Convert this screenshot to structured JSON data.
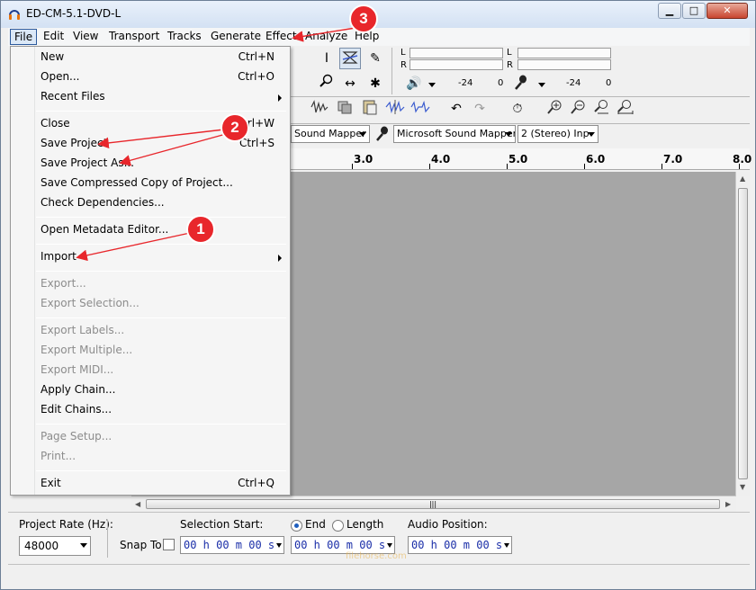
{
  "window": {
    "title": "ED-CM-5.1-DVD-L"
  },
  "menubar": {
    "items": [
      {
        "label": "File"
      },
      {
        "label": "Edit"
      },
      {
        "label": "View"
      },
      {
        "label": "Transport"
      },
      {
        "label": "Tracks"
      },
      {
        "label": "Generate"
      },
      {
        "label": "Effect"
      },
      {
        "label": "Analyze"
      },
      {
        "label": "Help"
      }
    ]
  },
  "file_menu": {
    "items": [
      {
        "label": "New",
        "shortcut": "Ctrl+N"
      },
      {
        "label": "Open...",
        "shortcut": "Ctrl+O"
      },
      {
        "label": "Recent Files",
        "shortcut": ""
      },
      {
        "label": "Close",
        "shortcut": "Ctrl+W"
      },
      {
        "label": "Save Project",
        "shortcut": "Ctrl+S"
      },
      {
        "label": "Save Project As...",
        "shortcut": ""
      },
      {
        "label": "Save Compressed Copy of Project...",
        "shortcut": ""
      },
      {
        "label": "Check Dependencies...",
        "shortcut": ""
      },
      {
        "label": "Open Metadata Editor...",
        "shortcut": ""
      },
      {
        "label": "Import",
        "shortcut": ""
      },
      {
        "label": "Export...",
        "shortcut": ""
      },
      {
        "label": "Export Selection...",
        "shortcut": ""
      },
      {
        "label": "Export Labels...",
        "shortcut": ""
      },
      {
        "label": "Export Multiple...",
        "shortcut": ""
      },
      {
        "label": "Export MIDI...",
        "shortcut": ""
      },
      {
        "label": "Apply Chain...",
        "shortcut": ""
      },
      {
        "label": "Edit Chains...",
        "shortcut": ""
      },
      {
        "label": "Page Setup...",
        "shortcut": ""
      },
      {
        "label": "Print...",
        "shortcut": ""
      },
      {
        "label": "Exit",
        "shortcut": "Ctrl+Q"
      }
    ]
  },
  "meters": {
    "channel_l": "L",
    "channel_r": "R",
    "play_db": "-24",
    "play_zero": "0",
    "rec_db": "-24",
    "rec_zero": "0"
  },
  "devices": {
    "host": "Sound Mapper",
    "recording": "Microsoft Sound Mapper",
    "channels": "2 (Stereo) Inp"
  },
  "ruler": {
    "ticks": [
      "3.0",
      "4.0",
      "5.0",
      "6.0",
      "7.0",
      "8.0"
    ]
  },
  "selection_bar": {
    "project_rate_label": "Project Rate (Hz):",
    "project_rate_value": "48000",
    "snap_to_label": "Snap To",
    "selection_start_label": "Selection Start:",
    "end_label": "End",
    "length_label": "Length",
    "audio_position_label": "Audio Position:",
    "time_value": "00 h 00 m 00 s"
  },
  "annotations": [
    {
      "number": "1",
      "color": "#e8262b"
    },
    {
      "number": "2",
      "color": "#e8262b"
    },
    {
      "number": "3",
      "color": "#e8262b"
    }
  ],
  "watermark": "filehorse.com"
}
